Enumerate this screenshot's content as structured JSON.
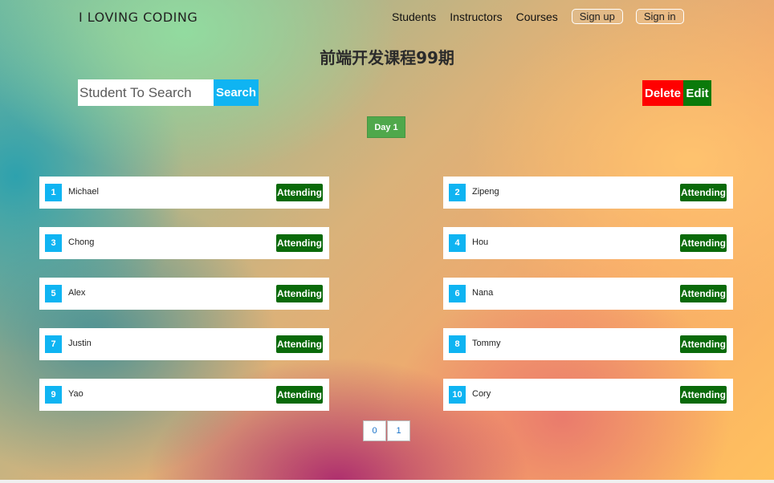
{
  "header": {
    "brand": "I LOVING CODING",
    "nav": [
      "Students",
      "Instructors",
      "Courses"
    ],
    "signup_label": "Sign up",
    "signin_label": "Sign in"
  },
  "page_title": "前端开发课程99期",
  "toolbar": {
    "search_placeholder": "Student To Search",
    "search_label": "Search",
    "delete_label": "Delete",
    "edit_label": "Edit",
    "day_label": "Day 1"
  },
  "students": [
    {
      "num": "1",
      "name": "Michael",
      "status": "Attending"
    },
    {
      "num": "2",
      "name": "Zipeng",
      "status": "Attending"
    },
    {
      "num": "3",
      "name": "Chong",
      "status": "Attending"
    },
    {
      "num": "4",
      "name": "Hou",
      "status": "Attending"
    },
    {
      "num": "5",
      "name": "Alex",
      "status": "Attending"
    },
    {
      "num": "6",
      "name": "Nana",
      "status": "Attending"
    },
    {
      "num": "7",
      "name": "Justin",
      "status": "Attending"
    },
    {
      "num": "8",
      "name": "Tommy",
      "status": "Attending"
    },
    {
      "num": "9",
      "name": "Yao",
      "status": "Attending"
    },
    {
      "num": "10",
      "name": "Cory",
      "status": "Attending"
    }
  ],
  "pagination": [
    "0",
    "1"
  ],
  "colors": {
    "accent": "#0fb4f2",
    "attending": "#0a6a0a",
    "delete": "#ff0000",
    "edit": "#0b7a0b",
    "day": "#4fa84b"
  }
}
